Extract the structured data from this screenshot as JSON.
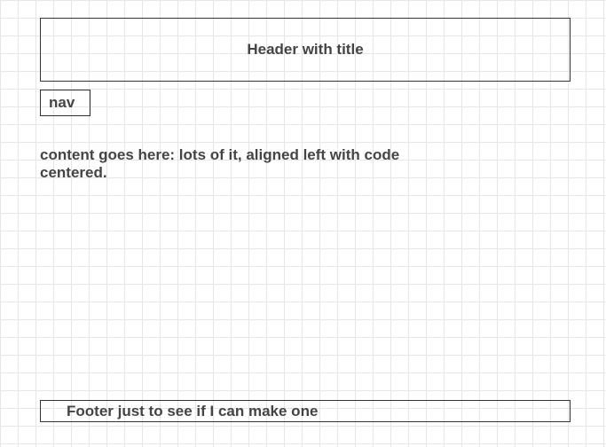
{
  "header": {
    "title": "Header with title"
  },
  "nav": {
    "label": "nav"
  },
  "content": {
    "text": "content goes here: lots of it, aligned left with code centered."
  },
  "footer": {
    "text": "Footer just to see if I can make one"
  },
  "colors": {
    "border": "#333333",
    "text": "#444444",
    "grid": "#e6e6e6",
    "background": "#ffffff"
  }
}
